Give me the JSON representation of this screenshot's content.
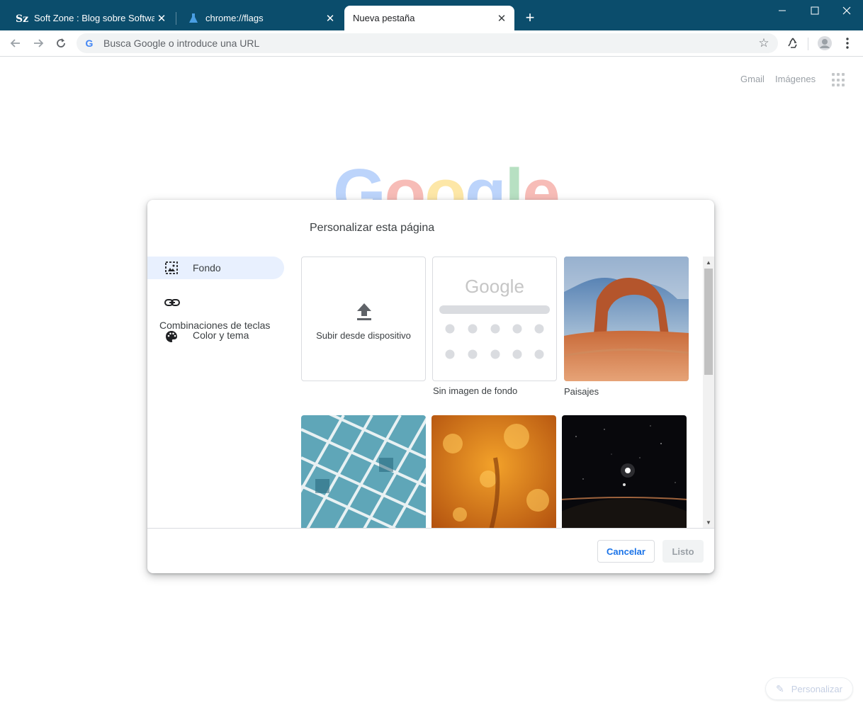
{
  "browser": {
    "tabs": [
      {
        "title": "Soft Zone : Blog sobre Software d",
        "favicon": "softzone-logo"
      },
      {
        "title": "chrome://flags",
        "favicon": "flask-icon"
      },
      {
        "title": "Nueva pestaña",
        "favicon": ""
      }
    ],
    "omnibox": {
      "placeholder": "Busca Google o introduce una URL"
    },
    "accent_color": "#0b4d6c"
  },
  "ntp": {
    "links": {
      "gmail": "Gmail",
      "images": "Imágenes"
    },
    "bg_logo": "Google",
    "customize_label": "Personalizar"
  },
  "dialog": {
    "title": "Personalizar esta página",
    "nav": [
      {
        "label": "Fondo",
        "icon": "image-icon",
        "selected": true
      },
      {
        "label": "Combinaciones de teclas",
        "icon": "link-icon",
        "selected": false
      },
      {
        "label": "Color y tema",
        "icon": "palette-icon",
        "selected": false
      }
    ],
    "tiles": {
      "upload": "Subir desde dispositivo",
      "no_image": "Sin imagen de fondo",
      "no_image_logo": "Google",
      "landscapes": "Paisajes"
    },
    "buttons": {
      "cancel": "Cancelar",
      "done": "Listo"
    }
  }
}
